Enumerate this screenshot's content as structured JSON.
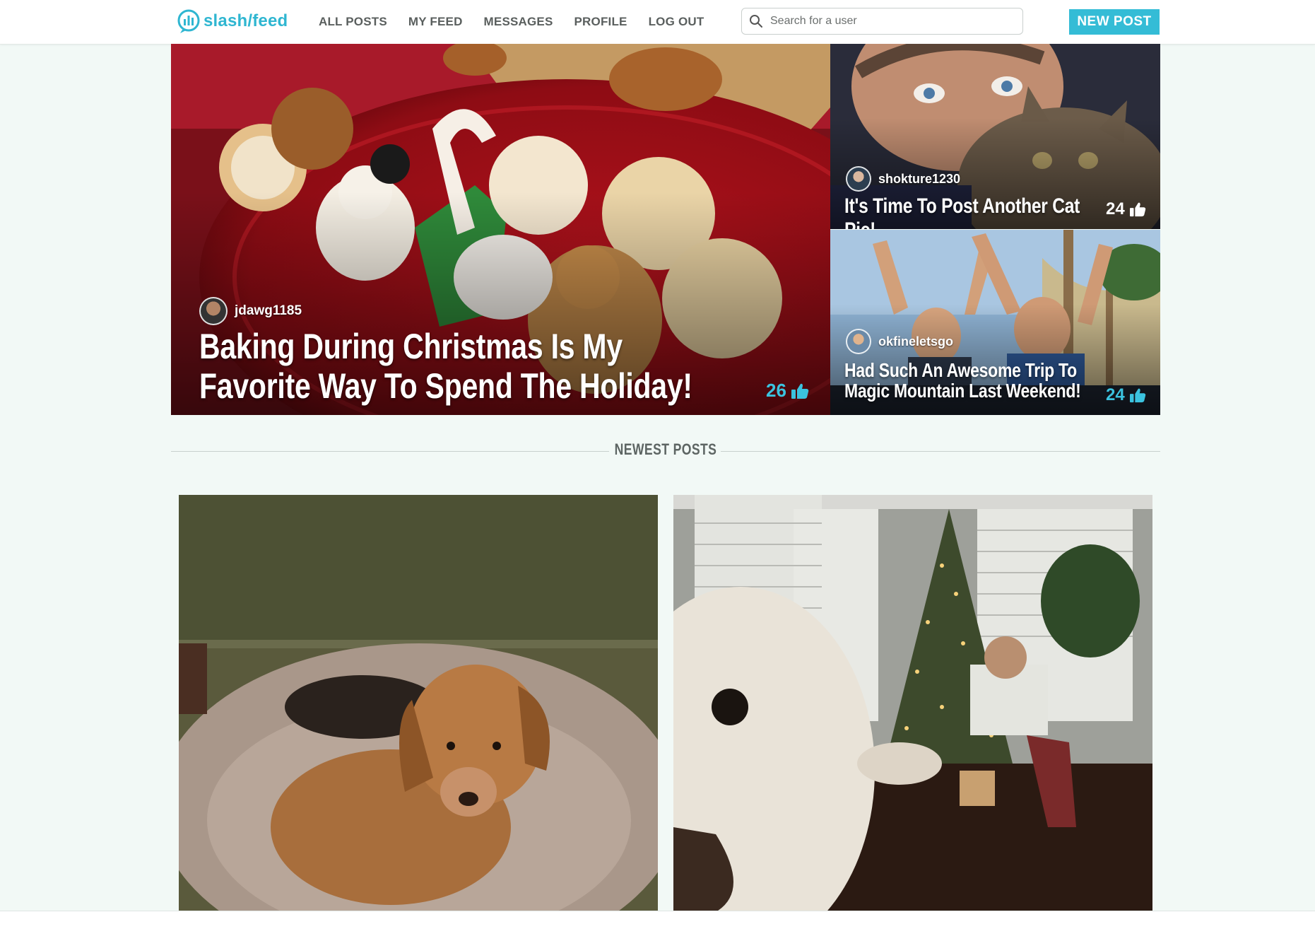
{
  "brand": {
    "name": "slash/feed",
    "accent": "#34bcd6"
  },
  "nav": {
    "items": [
      "ALL POSTS",
      "MY FEED",
      "MESSAGES",
      "PROFILE",
      "LOG OUT"
    ]
  },
  "search": {
    "placeholder": "Search for a user",
    "value": ""
  },
  "new_post_label": "NEW POST",
  "featured": [
    {
      "author": "jdawg1185",
      "title_line1": "Baking During Christmas Is My",
      "title_line2": "Favorite Way To Spend The Holiday!",
      "likes": "26",
      "image": "christmas cookies on red plate"
    },
    {
      "author": "shokture1230",
      "title_line1": "It's Time To Post Another Cat Pic!",
      "likes": "24",
      "image": "man kissing tabby cat"
    },
    {
      "author": "okfineletsgo",
      "title_line1": "Had Such An Awesome Trip To",
      "title_line2": "Magic Mountain Last Weekend!",
      "likes": "24",
      "image": "people cheering on roller coaster"
    }
  ],
  "section": {
    "title": "NEWEST POSTS"
  },
  "newest": [
    {
      "image": "brown dog lying in fluffy bed"
    },
    {
      "image": "dog close-up with christmas tree and child"
    }
  ]
}
